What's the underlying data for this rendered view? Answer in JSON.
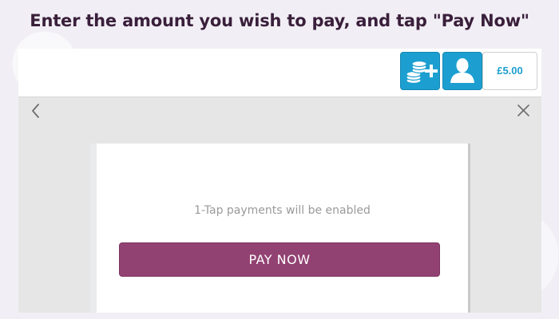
{
  "instruction": {
    "text": "Enter the amount you wish to pay, and tap \"Pay Now\""
  },
  "header": {
    "balance": "£5.00",
    "icons": {
      "add_credit": "coins-plus-icon",
      "account": "user-silhouette-icon"
    }
  },
  "nav": {
    "back_icon": "chevron-left-icon",
    "close_icon": "close-icon"
  },
  "panel": {
    "message": "1-Tap payments will be enabled",
    "pay_button_label": "PAY NOW"
  },
  "colors": {
    "accent_blue": "#1c9fd0",
    "pay_button": "#924272",
    "instruction_text": "#3a1f3b"
  }
}
